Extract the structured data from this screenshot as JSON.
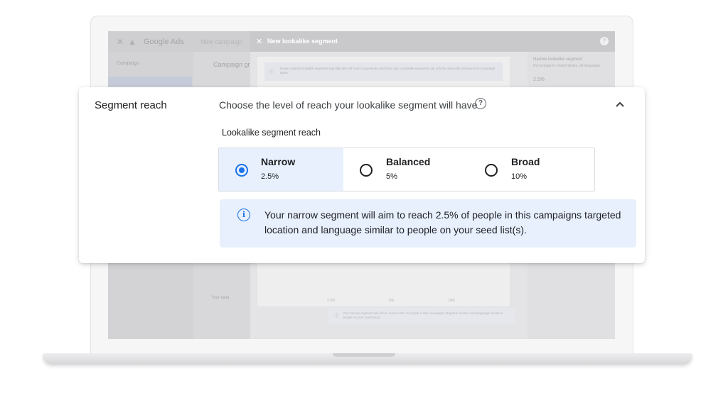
{
  "background_app": {
    "brand": "Google Ads",
    "breadcrumb": "New campaign",
    "nav_item": "Campaign",
    "column_title": "Campaign gr",
    "your_data_label": "Your data",
    "panel_title": "New lookalike segment",
    "info_text": "Newly created lookalike segments typically take 48 hours to generate and show ads. Lookalike segments can only be used with Demand Gen campaign types.",
    "side_title": "Narrow lookalike segment",
    "side_desc": "Percentage in United States, all languages",
    "side_value": "2.5%",
    "mini_options": [
      "2.5%",
      "5%",
      "10%"
    ],
    "mini_notice": "Your narrow segment will aim to reach 2.5% of people in this campaigns targeted location and language similar to people on your seed list(s)."
  },
  "section": {
    "title": "Segment reach",
    "prompt": "Choose the level of reach your lookalike segment will have",
    "help_icon": "help-icon",
    "collapse_icon": "chevron-up-icon"
  },
  "reach": {
    "label": "Lookalike segment reach",
    "options": [
      {
        "name": "Narrow",
        "percent": "2.5%",
        "selected": true
      },
      {
        "name": "Balanced",
        "percent": "5%",
        "selected": false
      },
      {
        "name": "Broad",
        "percent": "10%",
        "selected": false
      }
    ]
  },
  "notice": {
    "icon": "info-icon",
    "text": "Your narrow segment will aim to reach 2.5% of people in this campaigns targeted location and language similar to people on your seed list(s)."
  },
  "colors": {
    "accent": "#1a73e8",
    "selected_bg": "#e8f0fe",
    "notice_bg": "#e8f0fe"
  }
}
